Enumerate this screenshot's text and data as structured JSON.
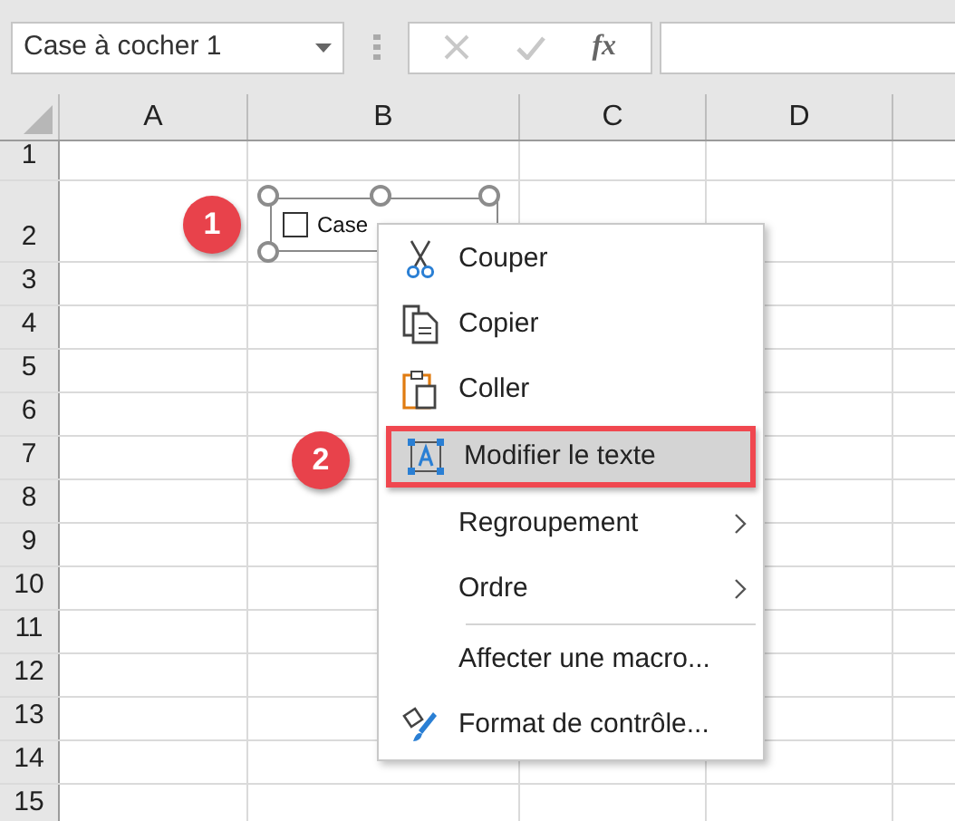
{
  "name_box": {
    "value": "Case à cocher 1"
  },
  "formula_bar": {
    "fx": "fx"
  },
  "columns": [
    "A",
    "B",
    "C",
    "D"
  ],
  "rows": [
    "1",
    "2",
    "3",
    "4",
    "5",
    "6",
    "7",
    "8",
    "9",
    "10",
    "11",
    "12",
    "13",
    "14",
    "15"
  ],
  "checkbox_control": {
    "label": "Case",
    "checked": false
  },
  "context_menu": [
    {
      "kind": "item",
      "label": "Couper",
      "selected": false,
      "submenu": false
    },
    {
      "kind": "item",
      "label": "Copier",
      "selected": false,
      "submenu": false
    },
    {
      "kind": "item",
      "label": "Coller",
      "selected": false,
      "submenu": false
    },
    {
      "kind": "item",
      "label": "Modifier le texte",
      "selected": true,
      "submenu": false
    },
    {
      "kind": "item",
      "label": "Regroupement",
      "selected": false,
      "submenu": true
    },
    {
      "kind": "item",
      "label": "Ordre",
      "selected": false,
      "submenu": true
    },
    {
      "kind": "separator"
    },
    {
      "kind": "item",
      "label": "Affecter une macro...",
      "selected": false,
      "submenu": false
    },
    {
      "kind": "item",
      "label": "Format de contrôle...",
      "selected": false,
      "submenu": false
    }
  ],
  "callouts": [
    "1",
    "2"
  ]
}
